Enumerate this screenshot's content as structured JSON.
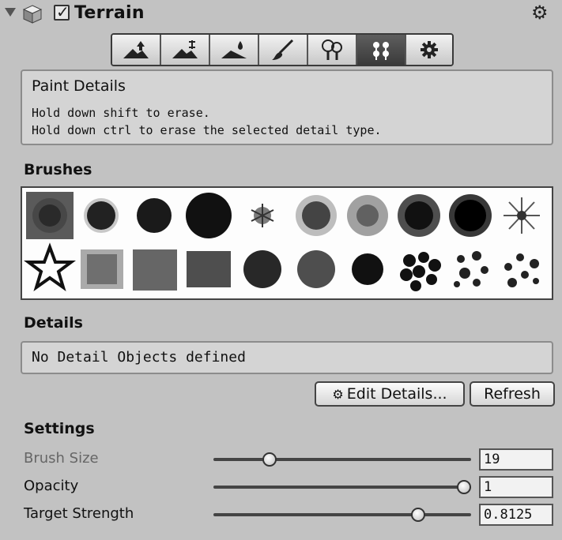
{
  "header": {
    "title": "Terrain",
    "enabled": true,
    "icons": [
      "foldout-arrow-icon",
      "terrain-cube-icon",
      "gear-icon"
    ]
  },
  "toolbar": {
    "tools": [
      {
        "name": "raise-lower-terrain",
        "icon": "mountain-raise-icon"
      },
      {
        "name": "paint-height",
        "icon": "mountain-height-icon"
      },
      {
        "name": "smooth-height",
        "icon": "mountain-smooth-icon"
      },
      {
        "name": "paint-texture",
        "icon": "paintbrush-icon"
      },
      {
        "name": "place-trees",
        "icon": "trees-icon"
      },
      {
        "name": "paint-details",
        "icon": "flowers-icon",
        "active": true
      },
      {
        "name": "terrain-settings",
        "icon": "gear-icon"
      }
    ]
  },
  "help": {
    "title": "Paint Details",
    "line1": "Hold down shift to erase.",
    "line2": "Hold down ctrl to erase the selected detail type."
  },
  "brushes": {
    "heading": "Brushes",
    "selected_index": 0,
    "count": 20
  },
  "details": {
    "heading": "Details",
    "message": "No Detail Objects defined",
    "edit_label": "Edit Details...",
    "refresh_label": "Refresh"
  },
  "settings": {
    "heading": "Settings",
    "brush_size": {
      "label": "Brush Size",
      "value": "19",
      "fraction": 0.2
    },
    "opacity": {
      "label": "Opacity",
      "value": "1",
      "fraction": 1.0
    },
    "target_strength": {
      "label": "Target Strength",
      "value": "0.8125",
      "fraction": 0.8125
    }
  },
  "colors": {
    "panel_bg": "#c2c2c2",
    "active_tool": "#4a4a4a",
    "grid_bg": "#fdfdfd",
    "disabled_label": "#666666"
  }
}
